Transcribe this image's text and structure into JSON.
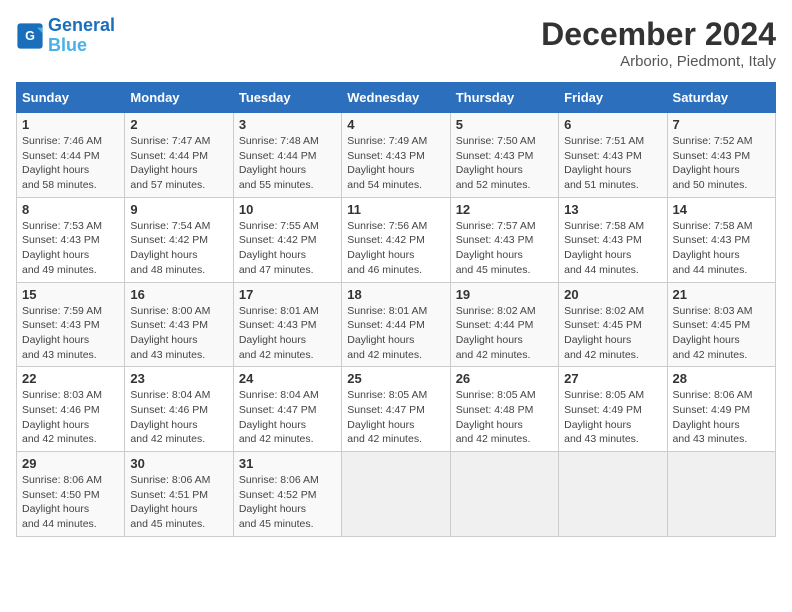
{
  "logo": {
    "line1": "General",
    "line2": "Blue"
  },
  "title": "December 2024",
  "subtitle": "Arborio, Piedmont, Italy",
  "weekdays": [
    "Sunday",
    "Monday",
    "Tuesday",
    "Wednesday",
    "Thursday",
    "Friday",
    "Saturday"
  ],
  "weeks": [
    [
      {
        "day": "1",
        "sunrise": "7:46 AM",
        "sunset": "4:44 PM",
        "daylight": "8 hours and 58 minutes."
      },
      {
        "day": "2",
        "sunrise": "7:47 AM",
        "sunset": "4:44 PM",
        "daylight": "8 hours and 57 minutes."
      },
      {
        "day": "3",
        "sunrise": "7:48 AM",
        "sunset": "4:44 PM",
        "daylight": "8 hours and 55 minutes."
      },
      {
        "day": "4",
        "sunrise": "7:49 AM",
        "sunset": "4:43 PM",
        "daylight": "8 hours and 54 minutes."
      },
      {
        "day": "5",
        "sunrise": "7:50 AM",
        "sunset": "4:43 PM",
        "daylight": "8 hours and 52 minutes."
      },
      {
        "day": "6",
        "sunrise": "7:51 AM",
        "sunset": "4:43 PM",
        "daylight": "8 hours and 51 minutes."
      },
      {
        "day": "7",
        "sunrise": "7:52 AM",
        "sunset": "4:43 PM",
        "daylight": "8 hours and 50 minutes."
      }
    ],
    [
      {
        "day": "8",
        "sunrise": "7:53 AM",
        "sunset": "4:43 PM",
        "daylight": "8 hours and 49 minutes."
      },
      {
        "day": "9",
        "sunrise": "7:54 AM",
        "sunset": "4:42 PM",
        "daylight": "8 hours and 48 minutes."
      },
      {
        "day": "10",
        "sunrise": "7:55 AM",
        "sunset": "4:42 PM",
        "daylight": "8 hours and 47 minutes."
      },
      {
        "day": "11",
        "sunrise": "7:56 AM",
        "sunset": "4:42 PM",
        "daylight": "8 hours and 46 minutes."
      },
      {
        "day": "12",
        "sunrise": "7:57 AM",
        "sunset": "4:43 PM",
        "daylight": "8 hours and 45 minutes."
      },
      {
        "day": "13",
        "sunrise": "7:58 AM",
        "sunset": "4:43 PM",
        "daylight": "8 hours and 44 minutes."
      },
      {
        "day": "14",
        "sunrise": "7:58 AM",
        "sunset": "4:43 PM",
        "daylight": "8 hours and 44 minutes."
      }
    ],
    [
      {
        "day": "15",
        "sunrise": "7:59 AM",
        "sunset": "4:43 PM",
        "daylight": "8 hours and 43 minutes."
      },
      {
        "day": "16",
        "sunrise": "8:00 AM",
        "sunset": "4:43 PM",
        "daylight": "8 hours and 43 minutes."
      },
      {
        "day": "17",
        "sunrise": "8:01 AM",
        "sunset": "4:43 PM",
        "daylight": "8 hours and 42 minutes."
      },
      {
        "day": "18",
        "sunrise": "8:01 AM",
        "sunset": "4:44 PM",
        "daylight": "8 hours and 42 minutes."
      },
      {
        "day": "19",
        "sunrise": "8:02 AM",
        "sunset": "4:44 PM",
        "daylight": "8 hours and 42 minutes."
      },
      {
        "day": "20",
        "sunrise": "8:02 AM",
        "sunset": "4:45 PM",
        "daylight": "8 hours and 42 minutes."
      },
      {
        "day": "21",
        "sunrise": "8:03 AM",
        "sunset": "4:45 PM",
        "daylight": "8 hours and 42 minutes."
      }
    ],
    [
      {
        "day": "22",
        "sunrise": "8:03 AM",
        "sunset": "4:46 PM",
        "daylight": "8 hours and 42 minutes."
      },
      {
        "day": "23",
        "sunrise": "8:04 AM",
        "sunset": "4:46 PM",
        "daylight": "8 hours and 42 minutes."
      },
      {
        "day": "24",
        "sunrise": "8:04 AM",
        "sunset": "4:47 PM",
        "daylight": "8 hours and 42 minutes."
      },
      {
        "day": "25",
        "sunrise": "8:05 AM",
        "sunset": "4:47 PM",
        "daylight": "8 hours and 42 minutes."
      },
      {
        "day": "26",
        "sunrise": "8:05 AM",
        "sunset": "4:48 PM",
        "daylight": "8 hours and 42 minutes."
      },
      {
        "day": "27",
        "sunrise": "8:05 AM",
        "sunset": "4:49 PM",
        "daylight": "8 hours and 43 minutes."
      },
      {
        "day": "28",
        "sunrise": "8:06 AM",
        "sunset": "4:49 PM",
        "daylight": "8 hours and 43 minutes."
      }
    ],
    [
      {
        "day": "29",
        "sunrise": "8:06 AM",
        "sunset": "4:50 PM",
        "daylight": "8 hours and 44 minutes."
      },
      {
        "day": "30",
        "sunrise": "8:06 AM",
        "sunset": "4:51 PM",
        "daylight": "8 hours and 45 minutes."
      },
      {
        "day": "31",
        "sunrise": "8:06 AM",
        "sunset": "4:52 PM",
        "daylight": "8 hours and 45 minutes."
      },
      null,
      null,
      null,
      null
    ]
  ]
}
